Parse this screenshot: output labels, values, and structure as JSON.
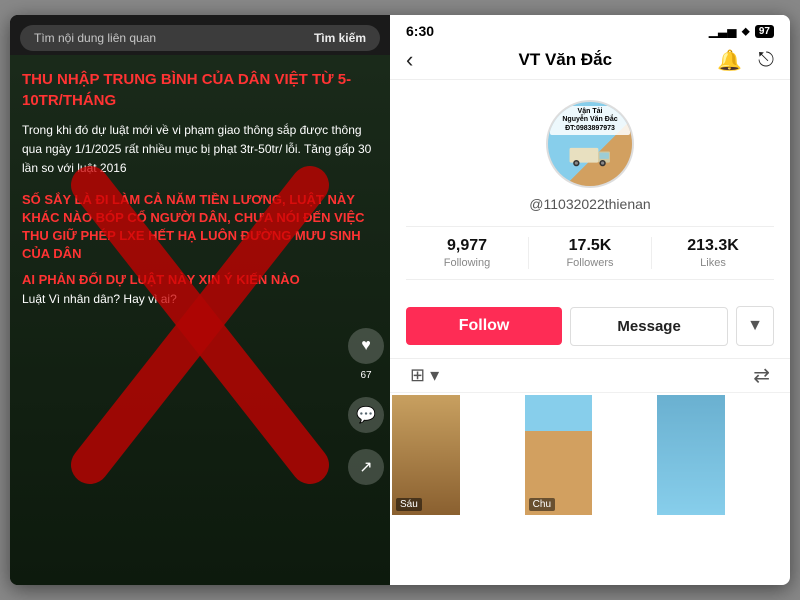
{
  "left": {
    "search_placeholder": "Tìm nội dung liên quan",
    "search_button": "Tìm kiếm",
    "title_red": "THU NHẬP TRUNG BÌNH CỦA DÂN VIỆT TỪ 5-10tr/tháng",
    "body1": "Trong khi đó dự luật mới về vi phạm giao thông sắp được thông qua ngày 1/1/2025 rất nhiều mục bị phạt 3tr-50tr/ lỗi. Tăng gấp 30 lần so với luật 2016",
    "section2_red": "SỐ SẮY LÀ ĐI LÀM CẢ NĂM TIỀN LƯƠNG, luật này khác nào bóp cổ người dân, chưa nói đến việc thu giữ phép lxe hết hạ luôn đường mưu sinh của dân",
    "section3_red": "AI PHẢN ĐỐI DỰ LUẬT NÀY XIN Ý KIẾN NÀO",
    "section3_white": "Luật  Vì nhân dân? Hay vì ai?",
    "like_count": "67"
  },
  "right": {
    "time": "6:30",
    "battery": "97",
    "profile_name": "VT Văn Đắc",
    "username": "@11032022thienan",
    "avatar_text_line1": "Vận Tải",
    "avatar_text_line2": "Nguyễn Văn Đắc",
    "avatar_text_line3": "ĐT:0983897973",
    "stats": [
      {
        "number": "9,977",
        "label": "Following"
      },
      {
        "number": "17.5K",
        "label": "Followers"
      },
      {
        "number": "213.3K",
        "label": "Likes"
      }
    ],
    "follow_button": "Follow",
    "message_button": "Message",
    "more_button": "▼",
    "thumb_labels": [
      "Sáu",
      "Chu"
    ]
  }
}
